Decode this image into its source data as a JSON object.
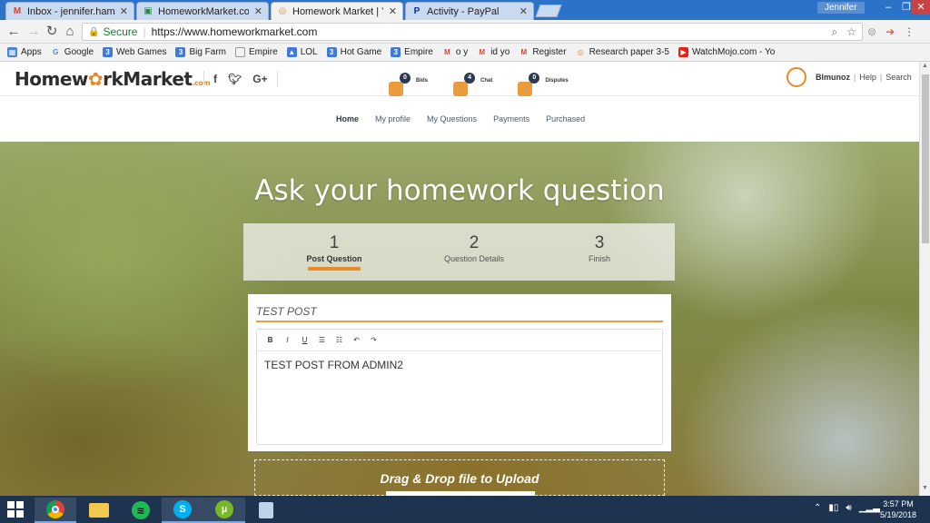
{
  "browser": {
    "tabs": [
      {
        "title": "Inbox - jennifer.hamzic@",
        "favicon": "gmail-icon",
        "active": false
      },
      {
        "title": "HomeworkMarket.com -",
        "favicon": "hm-icon",
        "active": false
      },
      {
        "title": "Homework Market | Your",
        "favicon": "hm-icon",
        "active": true
      },
      {
        "title": "Activity - PayPal",
        "favicon": "paypal-icon",
        "active": false
      }
    ],
    "user_name": "Jennifer",
    "address": {
      "secure_label": "Secure",
      "url": "https://www.homeworkmarket.com"
    },
    "bookmarks": [
      {
        "label": "Apps",
        "icon": "apps-grid-icon",
        "color": "#4a84d8"
      },
      {
        "label": "Google",
        "icon": "google-icon",
        "color": "#4285f4"
      },
      {
        "label": "Web Games",
        "icon": "bookmark-3-icon",
        "color": "#3f7bd6"
      },
      {
        "label": "Big Farm",
        "icon": "bookmark-3-icon",
        "color": "#3f7bd6"
      },
      {
        "label": "Empire",
        "icon": "page-icon",
        "color": "#999999"
      },
      {
        "label": "LOL",
        "icon": "bookmark-image-icon",
        "color": "#3f7bd6"
      },
      {
        "label": "Hot Game",
        "icon": "bookmark-3-icon",
        "color": "#3f7bd6"
      },
      {
        "label": "Empire",
        "icon": "bookmark-3-icon",
        "color": "#3f7bd6"
      },
      {
        "label": "o y",
        "icon": "gmail-icon",
        "color": "#d44638"
      },
      {
        "label": "id yo",
        "icon": "gmail-icon",
        "color": "#d44638"
      },
      {
        "label": "Register",
        "icon": "gmail-icon",
        "color": "#d44638"
      },
      {
        "label": "Research paper 3-5",
        "icon": "hm-icon",
        "color": "#e78a2a"
      },
      {
        "label": "WatchMojo.com - Yo",
        "icon": "youtube-icon",
        "color": "#e62117"
      }
    ]
  },
  "site": {
    "logo": {
      "part1": "Homew",
      "part2": "rkMarket",
      "suffix": ".com"
    },
    "socials": [
      "f",
      "t",
      "G+"
    ],
    "counters": [
      {
        "label": "Bids",
        "count": "0"
      },
      {
        "label": "Chat",
        "count": "4"
      },
      {
        "label": "Disputes",
        "count": "0"
      }
    ],
    "user": {
      "name": "Blmunoz",
      "help": "Help",
      "search": "Search"
    },
    "nav": [
      "Home",
      "My profile",
      "My Questions",
      "Payments",
      "Purchased"
    ],
    "active_nav": "Home"
  },
  "hero": {
    "title": "Ask your homework question",
    "steps": [
      {
        "num": "1",
        "label": "Post Question",
        "active": true
      },
      {
        "num": "2",
        "label": "Question Details",
        "active": false
      },
      {
        "num": "3",
        "label": "Finish",
        "active": false
      }
    ],
    "form": {
      "title_value": "TEST POST",
      "body_value": "TEST POST FROM ADMIN2",
      "toolbar": [
        "B",
        "I",
        "U",
        "list-bulleted",
        "list-numbered",
        "undo",
        "redo"
      ]
    },
    "dropzone": {
      "label": "Drag & Drop file to Upload"
    }
  },
  "taskbar": {
    "apps": [
      "chrome-icon",
      "file-explorer-icon",
      "spotify-icon",
      "skype-icon",
      "utorrent-icon",
      "notepad-icon"
    ],
    "clock": {
      "time": "3:57 PM",
      "date": "5/19/2018"
    }
  }
}
